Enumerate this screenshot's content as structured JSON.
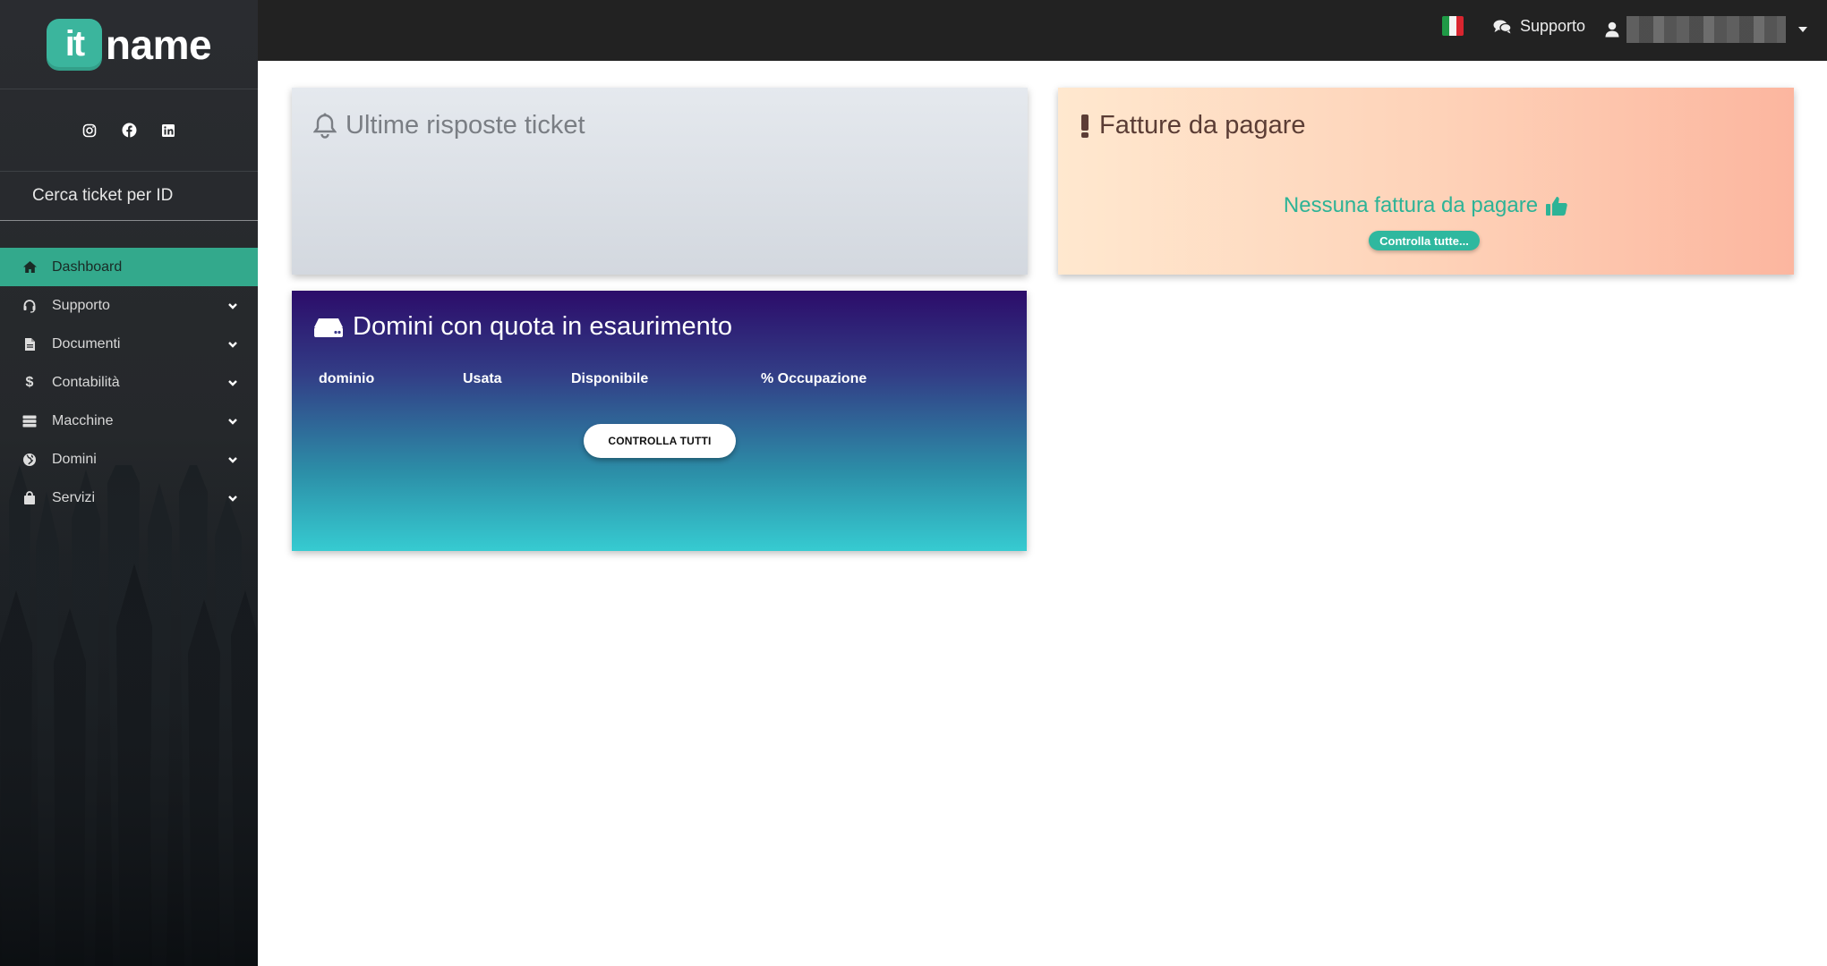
{
  "brand": {
    "logo_text": "name",
    "logo_badge_text": "it",
    "accent_color": "#33a98c"
  },
  "social": [
    {
      "name": "instagram-icon"
    },
    {
      "name": "facebook-icon"
    },
    {
      "name": "linkedin-icon"
    }
  ],
  "sidebar": {
    "search_label": "Cerca ticket per ID",
    "items": [
      {
        "label": "Dashboard",
        "icon": "home-icon",
        "active": true
      },
      {
        "label": "Supporto",
        "icon": "headset-icon"
      },
      {
        "label": "Documenti",
        "icon": "document-icon"
      },
      {
        "label": "Contabilità",
        "icon": "dollar-icon"
      },
      {
        "label": "Macchine",
        "icon": "server-icon"
      },
      {
        "label": "Domini",
        "icon": "globe-icon"
      },
      {
        "label": "Servizi",
        "icon": "bag-icon"
      }
    ]
  },
  "topbar": {
    "language": "Italiano",
    "support_label": "Supporto",
    "user_name": ""
  },
  "tickets_card": {
    "title": "Ultime risposte ticket"
  },
  "invoices_card": {
    "title": "Fatture da pagare",
    "message": "Nessuna fattura da pagare",
    "button_label": "Controlla tutte..."
  },
  "domains_card": {
    "title": "Domini con quota in esaurimento",
    "columns": [
      "dominio",
      "Usata",
      "Disponibile",
      "% Occupazione"
    ],
    "button_label": "CONTROLLA TUTTI"
  }
}
